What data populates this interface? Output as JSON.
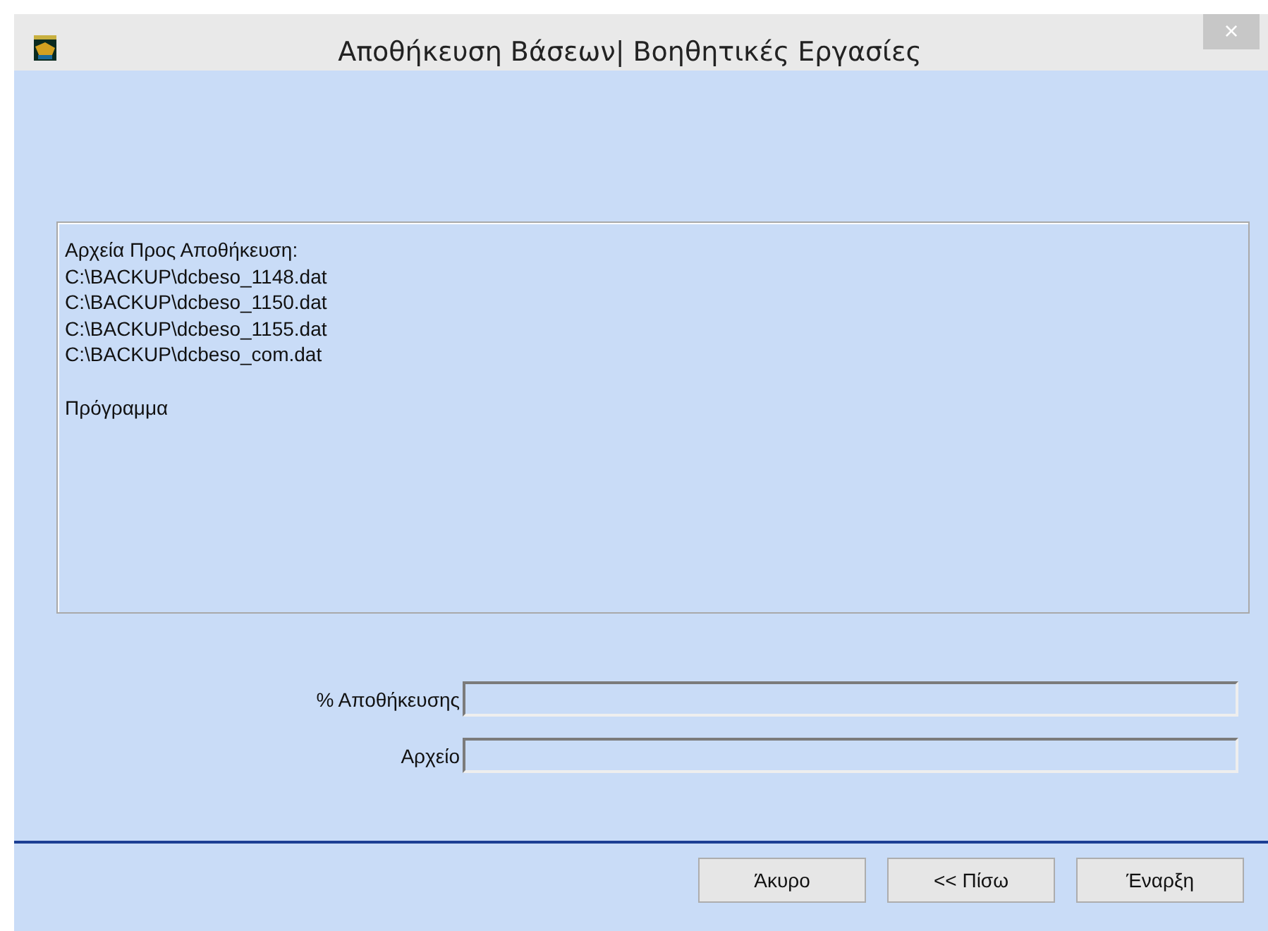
{
  "window": {
    "title": "Αποθήκευση Βάσεων| Βοηθητικές Εργασίες",
    "close": "×"
  },
  "file_list": {
    "lines": [
      "Αρχεία Προς Αποθήκευση:",
      "C:\\BACKUP\\dcbeso_1148.dat",
      "C:\\BACKUP\\dcbeso_1150.dat",
      "C:\\BACKUP\\dcbeso_1155.dat",
      "C:\\BACKUP\\dcbeso_com.dat"
    ],
    "footer": "Πρόγραμμα"
  },
  "fields": [
    {
      "label": "% Αποθήκευσης"
    },
    {
      "label": "Αρχείο"
    }
  ],
  "buttons": [
    "Άκυρο",
    "<< Πίσω",
    "Έναρξη"
  ]
}
